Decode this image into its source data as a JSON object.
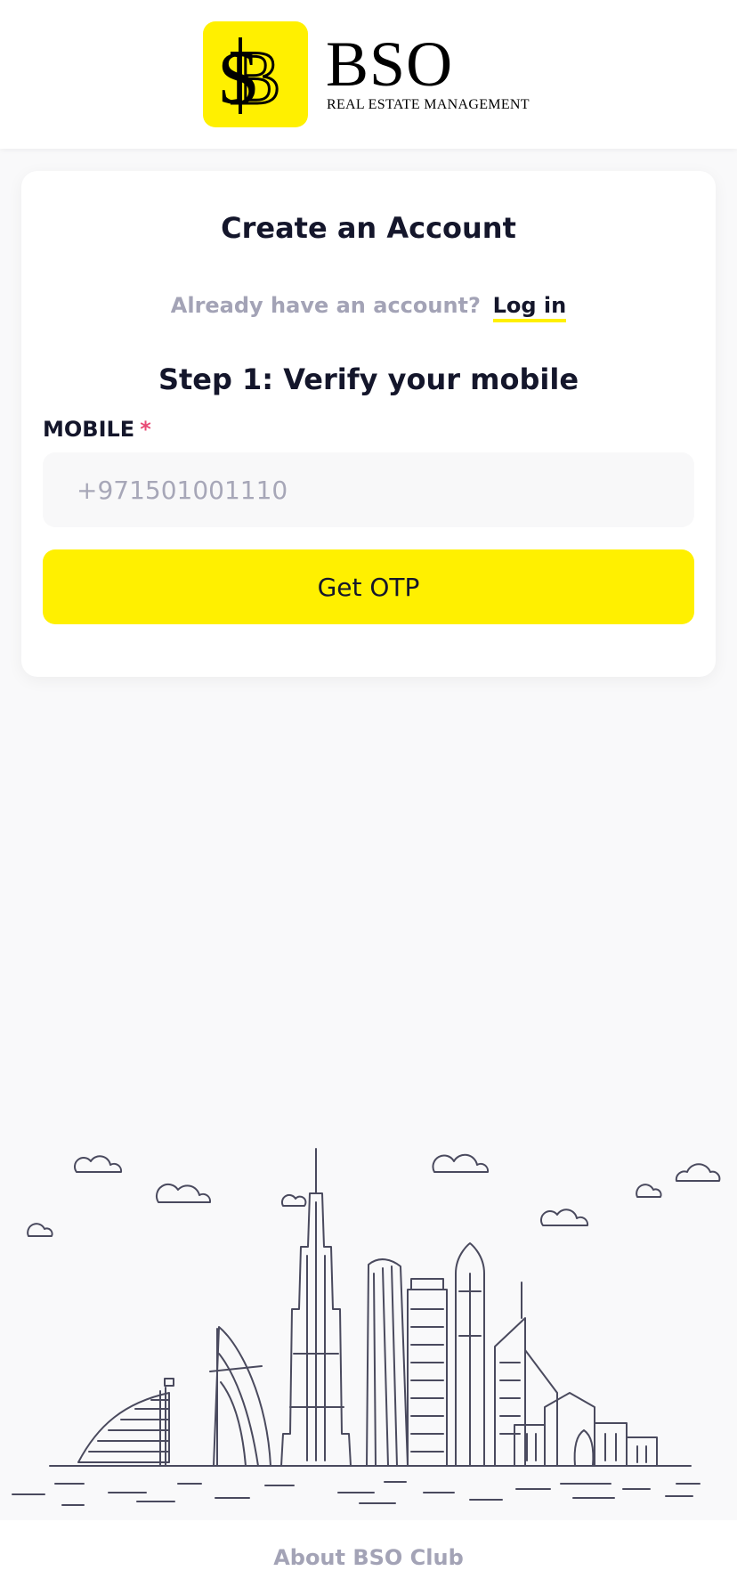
{
  "brand": {
    "name": "BSO",
    "tagline": "REAL ESTATE MANAGEMENT",
    "accent_color": "#fff000"
  },
  "form": {
    "title": "Create an Account",
    "login_prompt": "Already have an account?",
    "login_link": "Log in",
    "step_title": "Step 1: Verify your mobile",
    "mobile_label": "MOBILE",
    "required_mark": "*",
    "mobile_placeholder": "+971501001110",
    "submit_label": "Get OTP"
  },
  "illustration": {
    "icon": "dubai-skyline-illustration"
  },
  "footer": {
    "link_label": "About BSO Club"
  }
}
